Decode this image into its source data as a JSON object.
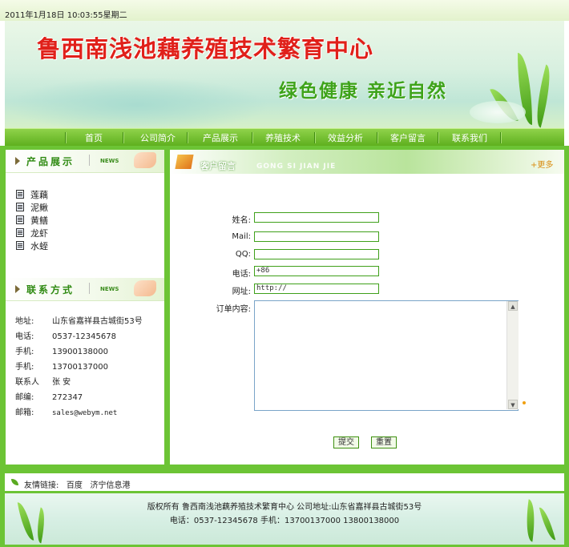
{
  "header": {
    "datetime": "2011年1月18日 10:03:55星期二",
    "site_title": "鲁西南浅池藕养殖技术繁育中心",
    "slogan": "绿色健康 亲近自然"
  },
  "nav": {
    "items": [
      "首页",
      "公司简介",
      "产品展示",
      "养殖技术",
      "效益分析",
      "客户留言",
      "联系我们"
    ]
  },
  "sidebar": {
    "products": {
      "title": "产品展示",
      "badge": "NEWS",
      "items": [
        "莲藕",
        "泥鳅",
        "黄鳝",
        "龙虾",
        "水蛭"
      ]
    },
    "contact": {
      "title": "联系方式",
      "badge": "NEWS",
      "rows": [
        {
          "label": "地址:",
          "value": "山东省嘉祥县古城街53号"
        },
        {
          "label": "电话:",
          "value": "0537-12345678"
        },
        {
          "label": "手机:",
          "value": "13900138000"
        },
        {
          "label": "手机:",
          "value": "13700137000"
        },
        {
          "label": "联系人",
          "value": "张 安"
        },
        {
          "label": "邮编:",
          "value": "272347"
        },
        {
          "label": "邮箱:",
          "value": "sales@webym.net"
        }
      ]
    }
  },
  "main": {
    "title": "客户留言",
    "subtitle": "GONG SI JIAN JIE",
    "more": "+更多",
    "form": {
      "name_label": "姓名:",
      "name_value": "",
      "mail_label": "Mail:",
      "mail_value": "",
      "qq_label": "QQ:",
      "qq_value": "",
      "phone_label": "电话:",
      "phone_value": "+86",
      "url_label": "网址:",
      "url_value": "http://",
      "content_label": "订单内容:",
      "content_value": "",
      "submit_label": "提交",
      "reset_label": "重置"
    }
  },
  "footer": {
    "links_label": "友情链接:",
    "links": [
      "百度",
      "济宁信息港"
    ],
    "copyright": "版权所有 鲁西南浅池藕养殖技术繁育中心 公司地址:山东省嘉祥县古城街53号",
    "contact_line": "电话：0537-12345678 手机：13700137000 13800138000"
  },
  "colors": {
    "accent_green": "#6cc435",
    "title_red": "#e0201a",
    "slogan_green": "#3ea31a",
    "more_orange": "#d98c10"
  }
}
